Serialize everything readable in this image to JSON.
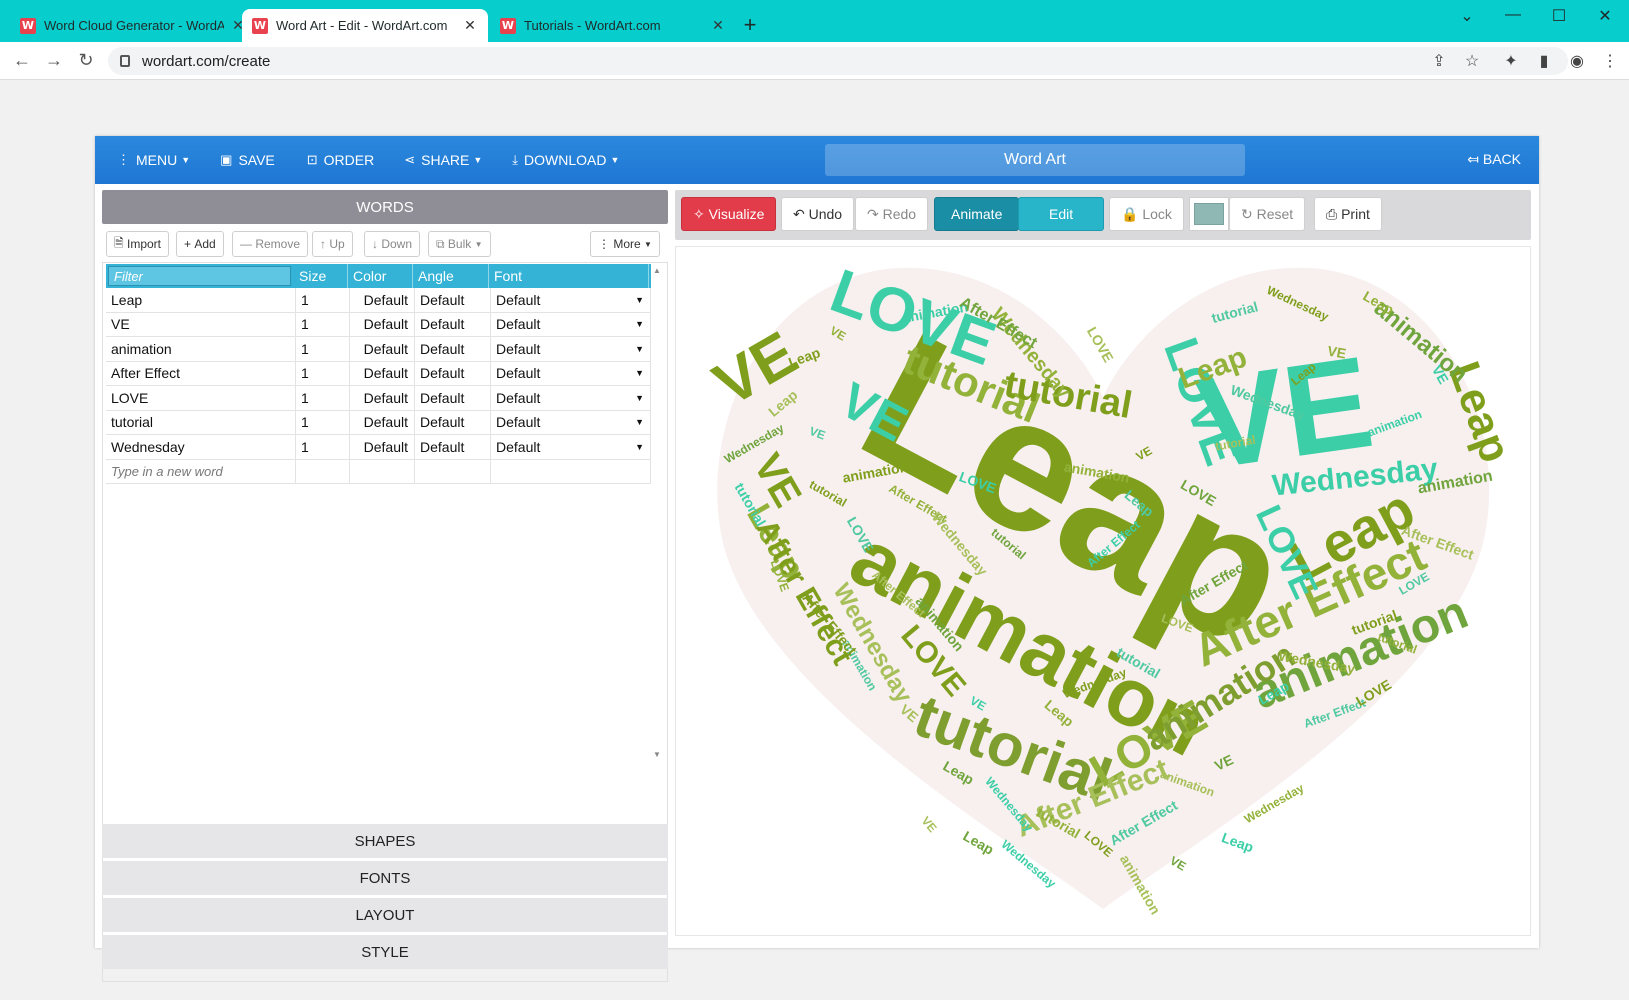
{
  "browser": {
    "tabs": [
      {
        "title": "Word Cloud Generator - WordArt.com",
        "active": false
      },
      {
        "title": "Word Art - Edit - WordArt.com",
        "active": true
      },
      {
        "title": "Tutorials - WordArt.com",
        "active": false
      }
    ],
    "url": "wordart.com/create"
  },
  "topnav": {
    "menu": "MENU",
    "save": "SAVE",
    "order": "ORDER",
    "share": "SHARE",
    "download": "DOWNLOAD",
    "title": "Word Art",
    "back": "BACK"
  },
  "words_panel": {
    "header": "WORDS",
    "toolbar": {
      "import": "Import",
      "add": "Add",
      "remove": "Remove",
      "up": "Up",
      "down": "Down",
      "bulk": "Bulk",
      "more": "More"
    },
    "columns": {
      "filter": "Filter",
      "size": "Size",
      "color": "Color",
      "angle": "Angle",
      "font": "Font"
    },
    "rows": [
      {
        "word": "Leap",
        "size": "1",
        "color": "Default",
        "angle": "Default",
        "font": "Default"
      },
      {
        "word": "VE",
        "size": "1",
        "color": "Default",
        "angle": "Default",
        "font": "Default"
      },
      {
        "word": "animation",
        "size": "1",
        "color": "Default",
        "angle": "Default",
        "font": "Default"
      },
      {
        "word": "After Effect",
        "size": "1",
        "color": "Default",
        "angle": "Default",
        "font": "Default"
      },
      {
        "word": "LOVE",
        "size": "1",
        "color": "Default",
        "angle": "Default",
        "font": "Default"
      },
      {
        "word": "tutorial",
        "size": "1",
        "color": "Default",
        "angle": "Default",
        "font": "Default"
      },
      {
        "word": "Wednesday",
        "size": "1",
        "color": "Default",
        "angle": "Default",
        "font": "Default"
      }
    ],
    "new_word_placeholder": "Type in a new word"
  },
  "sections": {
    "shapes": "SHAPES",
    "fonts": "FONTS",
    "layout": "LAYOUT",
    "style": "STYLE"
  },
  "canvas_toolbar": {
    "visualize": "Visualize",
    "undo": "Undo",
    "redo": "Redo",
    "animate": "Animate",
    "edit": "Edit",
    "lock": "Lock",
    "reset": "Reset",
    "print": "Print",
    "swatch_color": "#8fb8b5"
  },
  "colors": {
    "tab_bar": "#08cdcd",
    "nav_blue": "#2b88dd",
    "header_grey": "#8f8e96",
    "grid_header": "#34b3d6",
    "visualize_red": "#e23b49",
    "olive": "#7f9f1c",
    "teal": "#3ccfa7",
    "heart_bg": "#f8efef"
  }
}
